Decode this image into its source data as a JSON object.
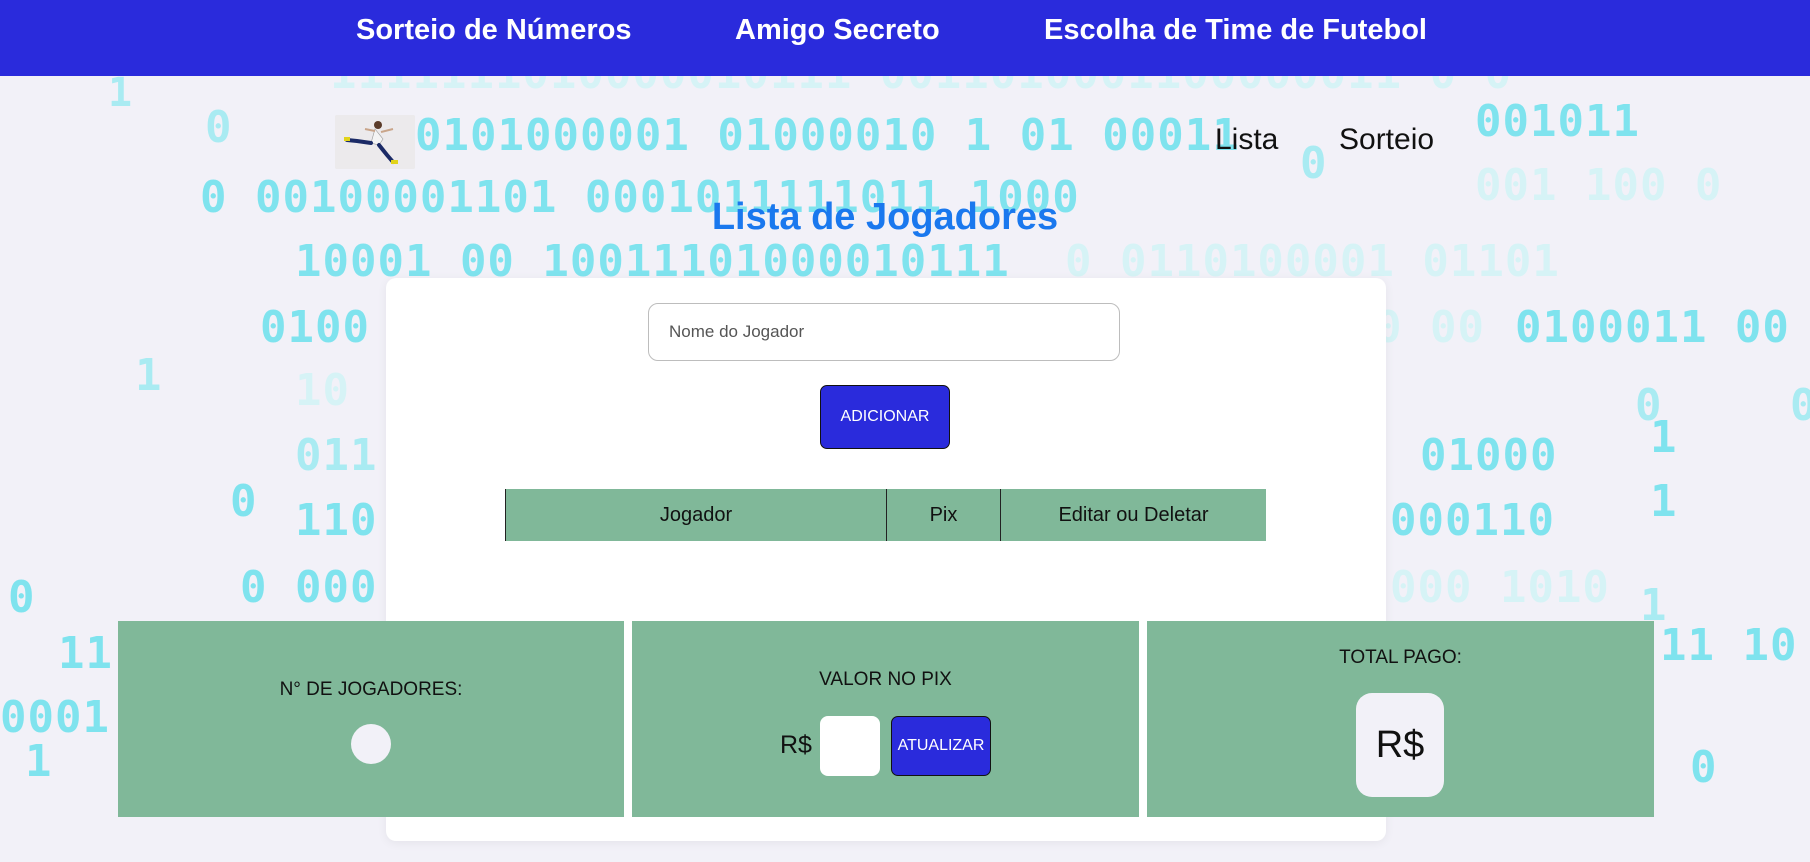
{
  "top_nav": {
    "items": [
      "Sorteio de Números",
      "Amigo Secreto",
      "Escolha de Time de Futebol"
    ]
  },
  "sub_nav": {
    "logo_icon": "soccer-player-logo-icon",
    "items": [
      "Lista",
      "Sorteio"
    ]
  },
  "main": {
    "title": "Lista de Jogadores",
    "name_input": {
      "placeholder": "Nome do Jogador",
      "value": ""
    },
    "add_button": "ADICIONAR",
    "table": {
      "headers": [
        "Jogador",
        "Pix",
        "Editar ou Deletar"
      ],
      "rows": []
    }
  },
  "stats": {
    "players_count": {
      "label": "N° DE JOGADORES:",
      "value": ""
    },
    "pix_value": {
      "label": "VALOR NO PIX",
      "currency": "R$",
      "input_value": "",
      "button": "ATUALIZAR"
    },
    "total_paid": {
      "label": "TOTAL PAGO:",
      "value": "R$"
    }
  },
  "colors": {
    "nav_bg": "#2a2bdc",
    "title": "#1a78ee",
    "panel_green": "#80b899",
    "button": "#2a2bdc",
    "page_bg": "#f2f1f8",
    "binary_digits": "#7fe3ee"
  }
}
